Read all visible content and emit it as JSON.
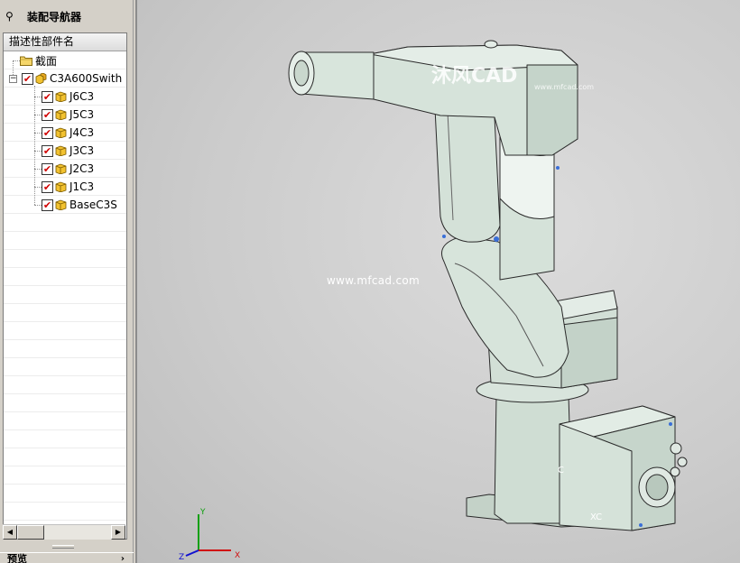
{
  "navigator": {
    "title": "装配导航器",
    "column_header": "描述性部件名",
    "nodes": [
      {
        "label": "截面",
        "type": "folder",
        "checked": false
      },
      {
        "label": "C3A600Swith",
        "type": "assembly",
        "checked": true
      },
      {
        "label": "J6C3",
        "type": "part",
        "checked": true
      },
      {
        "label": "J5C3",
        "type": "part",
        "checked": true
      },
      {
        "label": "J4C3",
        "type": "part",
        "checked": true
      },
      {
        "label": "J3C3",
        "type": "part",
        "checked": true
      },
      {
        "label": "J2C3",
        "type": "part",
        "checked": true
      },
      {
        "label": "J1C3",
        "type": "part",
        "checked": true
      },
      {
        "label": "BaseC3S",
        "type": "part",
        "checked": true
      }
    ],
    "preview_label": "预览",
    "expander_symbol": "−",
    "scroll_left": "◀",
    "scroll_right": "▶",
    "preview_arrow": "›"
  },
  "viewport": {
    "watermark_center": "www.mfcad.com",
    "watermark_top": "沐风CAD",
    "watermark_sub": "www.mfcad.com",
    "axis_x": "X",
    "axis_y": "Y",
    "axis_z": "Z",
    "label_xc": "XC",
    "label_c": "C"
  },
  "colors": {
    "robot_fill": "#d5e2d9",
    "robot_shadow": "#b4c4b9",
    "robot_stroke": "#2a2a2a",
    "axis_x": "#d01010",
    "axis_y": "#10a010",
    "axis_z": "#1010d0"
  }
}
